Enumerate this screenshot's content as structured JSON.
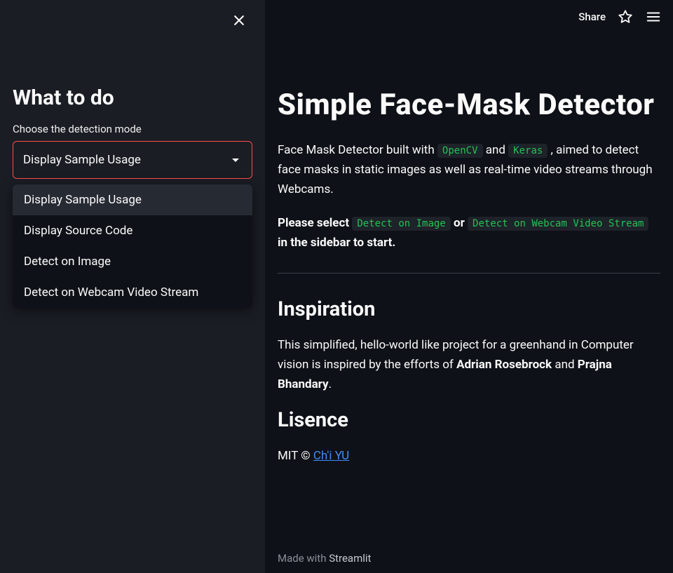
{
  "sidebar": {
    "title": "What to do",
    "select_label": "Choose the detection mode",
    "select_value": "Display Sample Usage",
    "options": {
      "o0": "Display Sample Usage",
      "o1": "Display Source Code",
      "o2": "Detect on Image",
      "o3": "Detect on Webcam Video Stream"
    }
  },
  "topbar": {
    "share": "Share"
  },
  "main": {
    "title": "Simple Face-Mask Detector",
    "intro_part1": "Face Mask Detector built with ",
    "intro_code1": "OpenCV",
    "intro_and": " and ",
    "intro_code2": "Keras",
    "intro_part2": " , aimed to detect face masks in static images as well as real-time video streams through Webcams.",
    "select_prompt_1": "Please select ",
    "select_code1": "Detect on Image",
    "select_or": " or ",
    "select_code2": "Detect on Webcam Video Stream",
    "select_prompt_2": " in the sidebar to start.",
    "inspiration_h": "Inspiration",
    "inspiration_p1": "This simplified, hello-world like project for a greenhand in Computer vision is inspired by the efforts of ",
    "inspiration_name1": "Adrian Rosebrock",
    "inspiration_and": " and ",
    "inspiration_name2": "Prajna Bhandary",
    "inspiration_period": ".",
    "license_h": "Lisence",
    "license_prefix": "MIT © ",
    "license_author": "Ch'i YU"
  },
  "footer": {
    "prefix": "Made with ",
    "brand": "Streamlit"
  }
}
